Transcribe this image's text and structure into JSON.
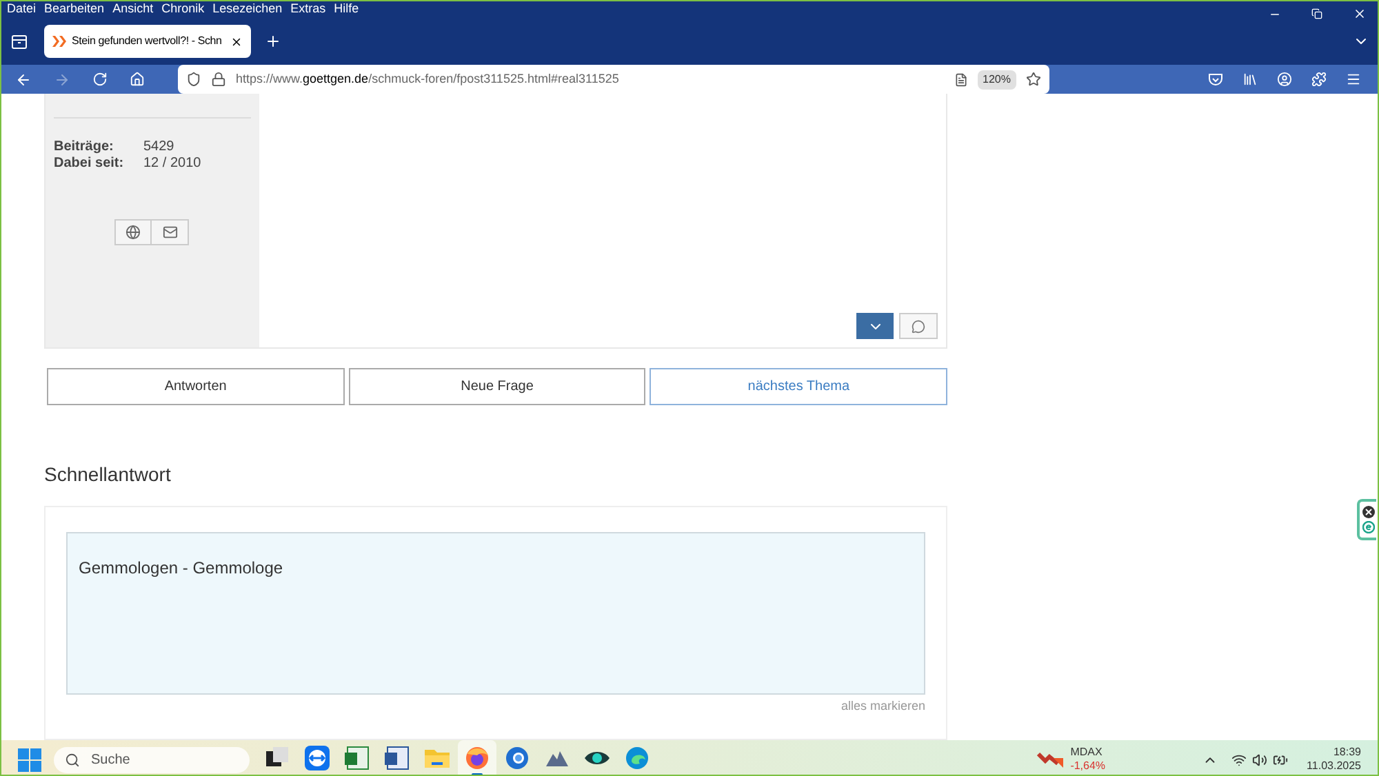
{
  "menu_bar": [
    "Datei",
    "Bearbeiten",
    "Ansicht",
    "Chronik",
    "Lesezeichen",
    "Extras",
    "Hilfe"
  ],
  "tabs": [
    {
      "label": "Stein gefunden wertvoll?! - Schn",
      "selected": true
    }
  ],
  "address_bar": {
    "url_prefix": "https://www.",
    "url_domain": "goettgen.de",
    "url_path": "/schmuck-foren/fpost311525.html#real311525",
    "zoom": "120%"
  },
  "user_info": [
    {
      "label": "Beiträge:",
      "value": "5429"
    },
    {
      "label": "Dabei seit:",
      "value": "12 / 2010"
    }
  ],
  "actions": [
    {
      "label": "Antworten",
      "kind": "plain"
    },
    {
      "label": "Neue Frage",
      "kind": "plain"
    },
    {
      "label": "nächstes Thema",
      "kind": "link"
    }
  ],
  "quick_reply": {
    "heading": "Schnellantwort",
    "value": "Gemmologen - Gemmologe ",
    "select_all": "alles markieren"
  },
  "taskbar": {
    "search_placeholder": "Suche",
    "apps": [
      {
        "kind": "taskview",
        "selected": false
      },
      {
        "kind": "remote",
        "selected": false
      },
      {
        "kind": "sheet",
        "selected": false
      },
      {
        "kind": "doc",
        "selected": false
      },
      {
        "kind": "folder",
        "selected": false
      },
      {
        "kind": "browser",
        "selected": true
      },
      {
        "kind": "mail",
        "selected": false
      },
      {
        "kind": "cloud",
        "selected": false
      },
      {
        "kind": "eye",
        "selected": false
      },
      {
        "kind": "edge",
        "selected": false
      }
    ],
    "ticker": {
      "name": "MDAX",
      "change": "-1,64%"
    },
    "time": "18:39",
    "date": "11.03.2025"
  }
}
